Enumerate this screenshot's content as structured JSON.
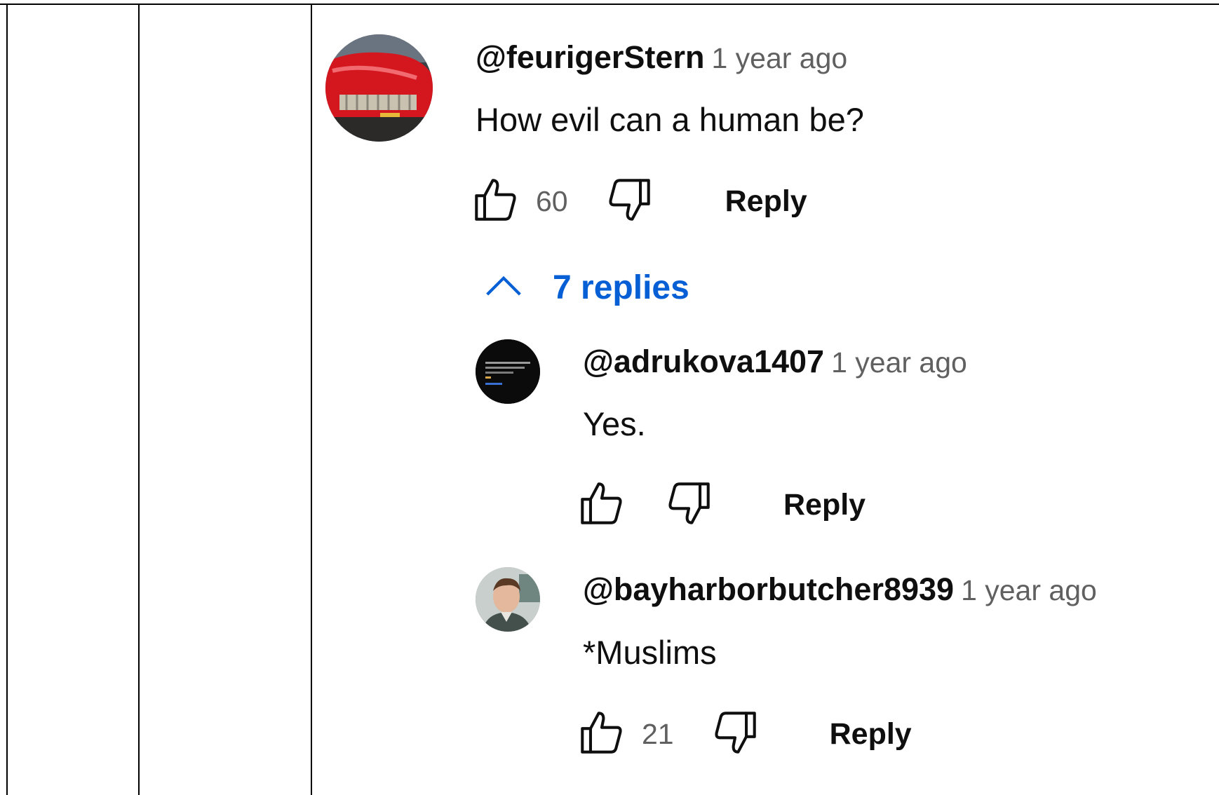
{
  "comment": {
    "author": "@feurigerStern",
    "time": "1 year ago",
    "text": "How evil can a human be?",
    "likes": "60",
    "reply_label": "Reply",
    "replies_toggle": "7 replies"
  },
  "replies": [
    {
      "author": "@adrukova1407",
      "time": "1 year ago",
      "text": "Yes.",
      "likes": "",
      "reply_label": "Reply"
    },
    {
      "author": "@bayharborbutcher8939",
      "time": "1 year ago",
      "text": "*Muslims",
      "likes": "21",
      "reply_label": "Reply"
    }
  ],
  "icons": {
    "like": "thumbs-up-icon",
    "dislike": "thumbs-down-icon",
    "toggle": "chevron-up-icon"
  },
  "colors": {
    "link_blue": "#065fd4",
    "meta_gray": "#606060",
    "text": "#0f0f0f"
  }
}
